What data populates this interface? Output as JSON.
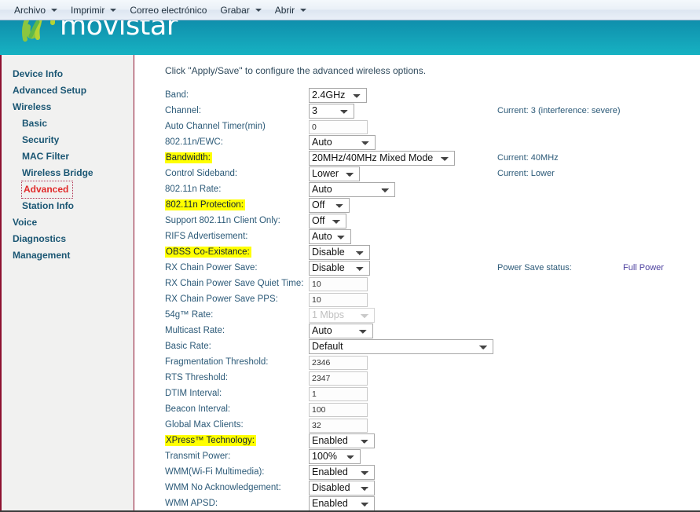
{
  "toolbar": {
    "items": [
      {
        "label": "Archivo",
        "caret": true
      },
      {
        "label": "Imprimir",
        "caret": true
      },
      {
        "label": "Correo electrónico",
        "caret": false
      },
      {
        "label": "Grabar",
        "caret": true
      },
      {
        "label": "Abrir",
        "caret": true
      }
    ]
  },
  "banner": {
    "brand": "movistar",
    "logo_icon": "movistar-m-logo",
    "background_color": "#14a2b8"
  },
  "sidebar": {
    "items": [
      {
        "label": "Device Info",
        "level": 0,
        "active": false
      },
      {
        "label": "Advanced Setup",
        "level": 0,
        "active": false
      },
      {
        "label": "Wireless",
        "level": 0,
        "active": false
      },
      {
        "label": "Basic",
        "level": 1,
        "active": false
      },
      {
        "label": "Security",
        "level": 1,
        "active": false
      },
      {
        "label": "MAC Filter",
        "level": 1,
        "active": false
      },
      {
        "label": "Wireless Bridge",
        "level": 1,
        "active": false
      },
      {
        "label": "Advanced",
        "level": 1,
        "active": true
      },
      {
        "label": "Station Info",
        "level": 1,
        "active": false
      },
      {
        "label": "Voice",
        "level": 0,
        "active": false
      },
      {
        "label": "Diagnostics",
        "level": 0,
        "active": false
      },
      {
        "label": "Management",
        "level": 0,
        "active": false
      }
    ],
    "active_color": "#e12b2b",
    "link_color": "#1a5673"
  },
  "main": {
    "intro": "Click \"Apply/Save\" to configure the advanced wireless options.",
    "highlight_color": "#ffff00",
    "rows": [
      {
        "label": "Band:",
        "highlight": false,
        "control": "select",
        "value": "2.4GHz",
        "width": "w-band",
        "disabled": false,
        "note": ""
      },
      {
        "label": "Channel:",
        "highlight": false,
        "control": "select",
        "value": "3",
        "width": "w-chan",
        "disabled": false,
        "note": "Current: 3 (interference: severe)"
      },
      {
        "label": "Auto Channel Timer(min)",
        "highlight": false,
        "control": "text",
        "value": "0",
        "width": "",
        "disabled": false,
        "note": ""
      },
      {
        "label": "802.11n/EWC:",
        "highlight": false,
        "control": "select",
        "value": "Auto",
        "width": "w-auto",
        "disabled": false,
        "note": ""
      },
      {
        "label": "Bandwidth:",
        "highlight": true,
        "control": "select",
        "value": "20MHz/40MHz Mixed Mode",
        "width": "w-bw",
        "disabled": false,
        "note": "Current: 40MHz"
      },
      {
        "label": "Control Sideband:",
        "highlight": false,
        "control": "select",
        "value": "Lower",
        "width": "w-lower",
        "disabled": false,
        "note": "Current: Lower"
      },
      {
        "label": "802.11n Rate:",
        "highlight": false,
        "control": "select",
        "value": "Auto",
        "width": "w-rate",
        "disabled": false,
        "note": ""
      },
      {
        "label": "802.11n Protection:",
        "highlight": true,
        "control": "select",
        "value": "Off",
        "width": "w-off",
        "disabled": false,
        "note": ""
      },
      {
        "label": "Support 802.11n Client Only:",
        "highlight": false,
        "control": "select",
        "value": "Off",
        "width": "w-off2",
        "disabled": false,
        "note": ""
      },
      {
        "label": "RIFS Advertisement:",
        "highlight": false,
        "control": "select",
        "value": "Auto",
        "width": "w-rifs",
        "disabled": false,
        "note": ""
      },
      {
        "label": "OBSS Co-Existance:",
        "highlight": true,
        "control": "select",
        "value": "Disable",
        "width": "w-dis",
        "disabled": false,
        "note": ""
      },
      {
        "label": "RX Chain Power Save:",
        "highlight": false,
        "control": "select",
        "value": "Disable",
        "width": "w-dis",
        "disabled": false,
        "note": "POWERSAVE"
      },
      {
        "label": "RX Chain Power Save Quiet Time:",
        "highlight": false,
        "control": "text",
        "value": "10",
        "width": "",
        "disabled": false,
        "note": ""
      },
      {
        "label": "RX Chain Power Save PPS:",
        "highlight": false,
        "control": "text",
        "value": "10",
        "width": "",
        "disabled": false,
        "note": ""
      },
      {
        "label": "54g™ Rate:",
        "highlight": false,
        "control": "select",
        "value": "1 Mbps",
        "width": "w-54g",
        "disabled": true,
        "note": ""
      },
      {
        "label": "Multicast Rate:",
        "highlight": false,
        "control": "select",
        "value": "Auto",
        "width": "w-mcast",
        "disabled": false,
        "note": ""
      },
      {
        "label": "Basic Rate:",
        "highlight": false,
        "control": "select",
        "value": "Default",
        "width": "w-basic",
        "disabled": false,
        "note": ""
      },
      {
        "label": "Fragmentation Threshold:",
        "highlight": false,
        "control": "text",
        "value": "2346",
        "width": "",
        "disabled": false,
        "note": ""
      },
      {
        "label": "RTS Threshold:",
        "highlight": false,
        "control": "text",
        "value": "2347",
        "width": "",
        "disabled": false,
        "note": ""
      },
      {
        "label": "DTIM Interval:",
        "highlight": false,
        "control": "text",
        "value": "1",
        "width": "",
        "disabled": false,
        "note": ""
      },
      {
        "label": "Beacon Interval:",
        "highlight": false,
        "control": "text",
        "value": "100",
        "width": "",
        "disabled": false,
        "note": ""
      },
      {
        "label": "Global Max Clients:",
        "highlight": false,
        "control": "text",
        "value": "32",
        "width": "",
        "disabled": false,
        "note": ""
      },
      {
        "label": "XPress™ Technology:",
        "highlight": true,
        "control": "select",
        "value": "Enabled",
        "width": "w-en",
        "disabled": false,
        "note": ""
      },
      {
        "label": "Transmit Power:",
        "highlight": false,
        "control": "select",
        "value": "100%",
        "width": "w-tp",
        "disabled": false,
        "note": ""
      },
      {
        "label": "WMM(Wi-Fi Multimedia):",
        "highlight": false,
        "control": "select",
        "value": "Enabled",
        "width": "w-en",
        "disabled": false,
        "note": ""
      },
      {
        "label": "WMM No Acknowledgement:",
        "highlight": false,
        "control": "select",
        "value": "Disabled",
        "width": "w-en",
        "disabled": false,
        "note": ""
      },
      {
        "label": "WMM APSD:",
        "highlight": false,
        "control": "select",
        "value": "Enabled",
        "width": "w-en",
        "disabled": false,
        "note": ""
      }
    ],
    "power_save_label": "Power Save status:",
    "power_save_value": "Full Power",
    "power_save_value_color": "#4b3f9e"
  }
}
